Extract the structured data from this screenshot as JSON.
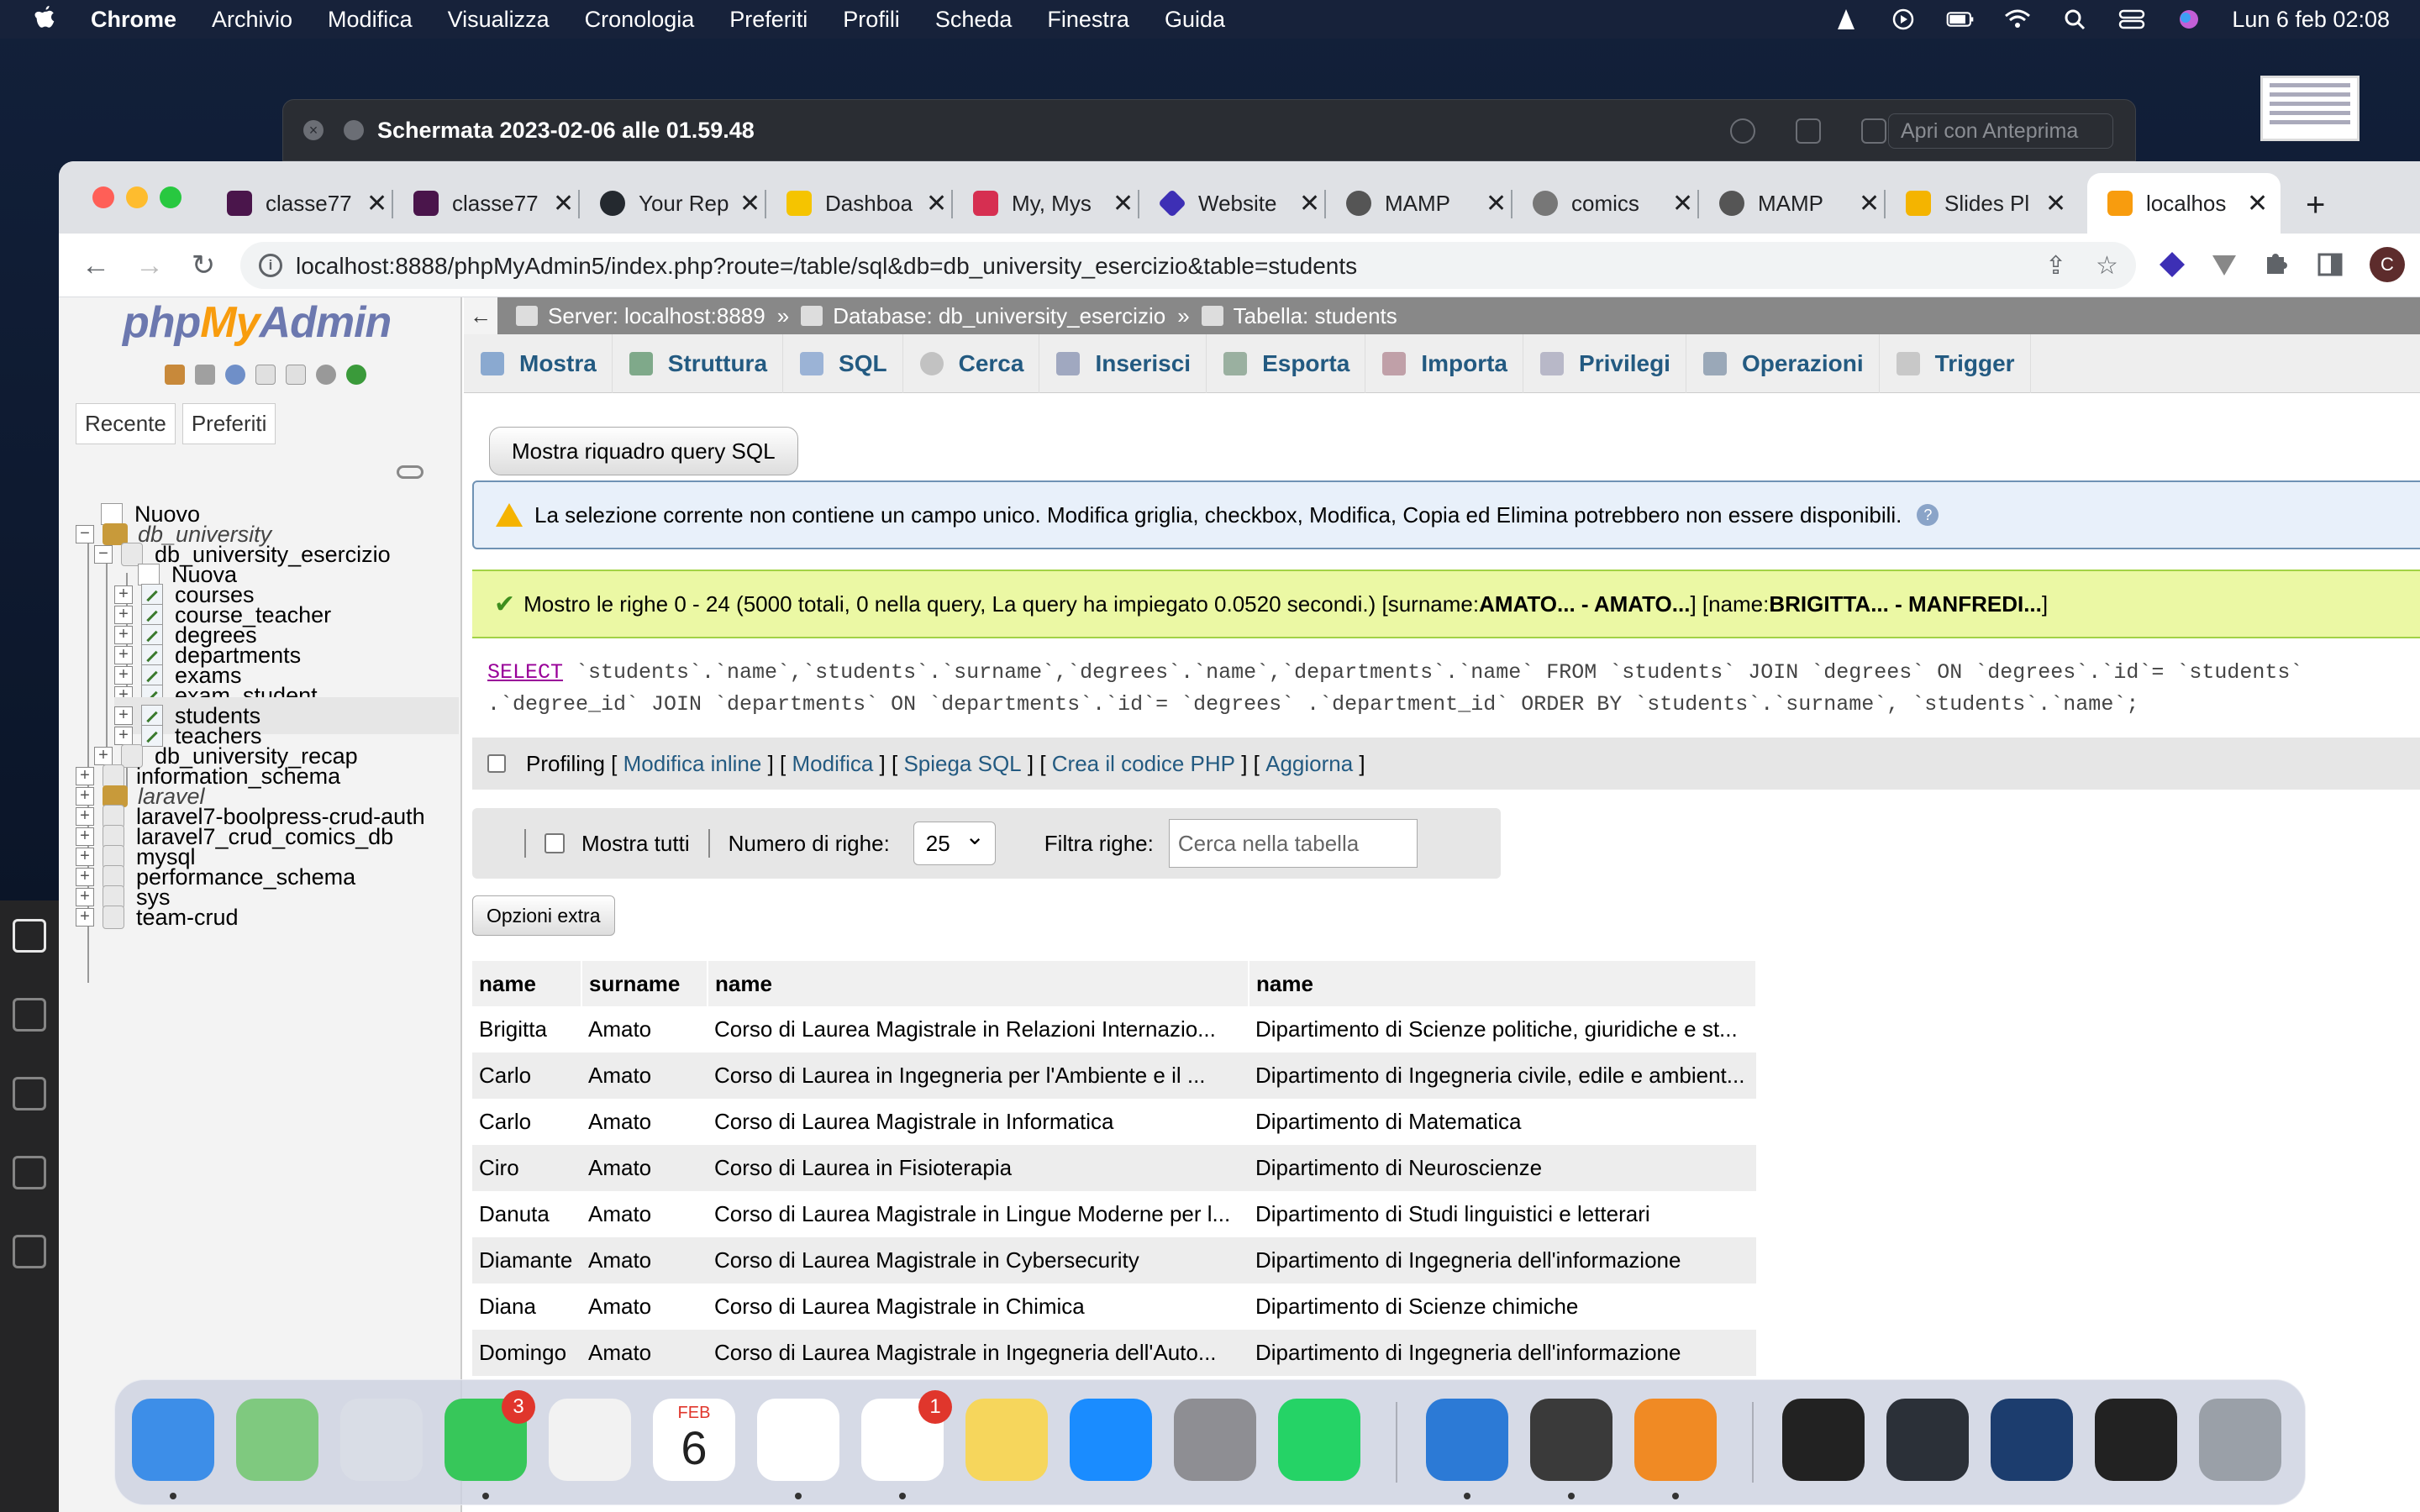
{
  "menubar": {
    "app": "Chrome",
    "items": [
      "Archivio",
      "Modifica",
      "Visualizza",
      "Cronologia",
      "Preferiti",
      "Profili",
      "Scheda",
      "Finestra",
      "Guida"
    ],
    "clock": "Lun 6 feb  02:08"
  },
  "preview": {
    "title": "Schermata 2023-02-06 alle 01.59.48",
    "open_with": "Apri con Anteprima"
  },
  "chrome": {
    "tabs": [
      {
        "title": "classe77",
        "color": "#4a154b"
      },
      {
        "title": "classe77",
        "color": "#4a154b"
      },
      {
        "title": "Your Rep",
        "color": "#24292f"
      },
      {
        "title": "Dashboa",
        "color": "#f5c400"
      },
      {
        "title": "My, Mys",
        "color": "#d62f51"
      },
      {
        "title": "Website",
        "color": "#3d2fb5"
      },
      {
        "title": "MAMP",
        "color": "#555555"
      },
      {
        "title": "comics",
        "color": "#777777"
      },
      {
        "title": "MAMP",
        "color": "#555555"
      },
      {
        "title": "Slides Pl",
        "color": "#f4b400"
      },
      {
        "title": "localhos",
        "color": "#f89c0e"
      }
    ],
    "url": "localhost:8888/phpMyAdmin5/index.php?route=/table/sql&db=db_university_esercizio&table=students",
    "avatar": "C"
  },
  "pma": {
    "logo_php": "php",
    "logo_my": "My",
    "logo_admin": "Admin",
    "nav_tabs": [
      "Recente",
      "Preferiti"
    ],
    "tree": {
      "new": "Nuovo",
      "db_university": "db_university",
      "db_esercizio": "db_university_esercizio",
      "new_table": "Nuova",
      "tables": [
        "courses",
        "course_teacher",
        "degrees",
        "departments",
        "exams",
        "exam_student",
        "students",
        "teachers"
      ],
      "db_recap": "db_university_recap",
      "other_dbs": [
        "information_schema",
        "laravel",
        "laravel7-boolpress-crud-auth",
        "laravel7_crud_comics_db",
        "mysql",
        "performance_schema",
        "sys",
        "team-crud"
      ]
    },
    "breadcrumb": {
      "server": "Server: localhost:8889",
      "database": "Database: db_university_esercizio",
      "table": "Tabella: students"
    },
    "top_tabs": [
      "Mostra",
      "Struttura",
      "SQL",
      "Cerca",
      "Inserisci",
      "Esporta",
      "Importa",
      "Privilegi",
      "Operazioni",
      "Trigger"
    ],
    "show_sql_button": "Mostra riquadro query SQL",
    "notice": "La selezione corrente non contiene un campo unico. Modifica griglia, checkbox, Modifica, Copia ed Elimina potrebbero non essere disponibili.",
    "success_prefix": "Mostro le righe 0 - 24 (5000 totali, 0 nella query, La query ha impiegato 0.0520 secondi.) [surname: ",
    "success_surname": "AMATO... - AMATO...",
    "success_mid": "] [name: ",
    "success_name": "BRIGITTA... - MANFREDI...",
    "success_end": "]",
    "sql_line1_kw": "SELECT",
    "sql_line1_rest": " `students`.`name`,`students`.`surname`,`degrees`.`name`,`departments`.`name` FROM `students` JOIN `degrees` ON `degrees`.`id`= `students`",
    "sql_line2": ".`degree_id` JOIN `departments` ON `departments`.`id`= `degrees` .`department_id` ORDER BY `students`.`surname`, `students`.`name`;",
    "links": {
      "profiling": "Profiling",
      "inline": "Modifica inline",
      "edit": "Modifica",
      "explain": "Spiega SQL",
      "php": "Crea il codice PHP",
      "refresh": "Aggiorna"
    },
    "filter": {
      "show_all": "Mostra tutti",
      "rows_label": "Numero di righe:",
      "rows_value": "25",
      "filter_label": "Filtra righe:",
      "filter_placeholder": "Cerca nella tabella"
    },
    "extra_options": "Opzioni extra",
    "table": {
      "headers": [
        "name",
        "surname",
        "name",
        "name"
      ],
      "rows": [
        [
          "Brigitta",
          "Amato",
          "Corso di Laurea Magistrale in Relazioni Internazio...",
          "Dipartimento di Scienze politiche, giuridiche e st..."
        ],
        [
          "Carlo",
          "Amato",
          "Corso di Laurea in Ingegneria per l'Ambiente e il ...",
          "Dipartimento di Ingegneria civile, edile e ambient..."
        ],
        [
          "Carlo",
          "Amato",
          "Corso di Laurea Magistrale in Informatica",
          "Dipartimento di Matematica"
        ],
        [
          "Ciro",
          "Amato",
          "Corso di Laurea in Fisioterapia",
          "Dipartimento di Neuroscienze"
        ],
        [
          "Danuta",
          "Amato",
          "Corso di Laurea Magistrale in Lingue Moderne per l...",
          "Dipartimento di Studi linguistici e letterari"
        ],
        [
          "Diamante",
          "Amato",
          "Corso di Laurea Magistrale in Cybersecurity",
          "Dipartimento di Ingegneria dell'informazione"
        ],
        [
          "Diana",
          "Amato",
          "Corso di Laurea Magistrale in Chimica",
          "Dipartimento di Scienze chimiche"
        ],
        [
          "Domingo",
          "Amato",
          "Corso di Laurea Magistrale in Ingegneria dell'Auto...",
          "Dipartimento di Ingegneria dell'informazione"
        ]
      ]
    }
  },
  "dock": {
    "apps": [
      {
        "name": "finder-app",
        "color": "#3d8ee8"
      },
      {
        "name": "maps-app",
        "color": "#7fc97f"
      },
      {
        "name": "launchpad-app",
        "color": "#d9dde6"
      },
      {
        "name": "messages-app",
        "color": "#37c75a",
        "badge": "3"
      },
      {
        "name": "photos-app",
        "color": "#f2f2f2"
      },
      {
        "name": "calendar-app",
        "color": "#ffffff",
        "month": "FEB",
        "day": "6"
      },
      {
        "name": "chrome-app",
        "color": "#ffffff"
      },
      {
        "name": "reminders-app",
        "color": "#ffffff",
        "badge": "1"
      },
      {
        "name": "notes-app",
        "color": "#f6d65c"
      },
      {
        "name": "app-store-app",
        "color": "#1a8cff"
      },
      {
        "name": "system-settings-app",
        "color": "#8e8e93"
      },
      {
        "name": "whatsapp-app",
        "color": "#25d366"
      },
      {
        "name": "vscode-app",
        "color": "#2c7ad6"
      },
      {
        "name": "mamp-app",
        "color": "#3a3a3a"
      },
      {
        "name": "vlc-app",
        "color": "#f08a24"
      },
      {
        "name": "stack-app",
        "color": "#222222"
      },
      {
        "name": "window-1",
        "color": "#2b3038"
      },
      {
        "name": "window-2",
        "color": "#1c3d6e"
      },
      {
        "name": "window-3",
        "color": "#222222"
      },
      {
        "name": "trash-app",
        "color": "#9aa0a8"
      }
    ]
  }
}
